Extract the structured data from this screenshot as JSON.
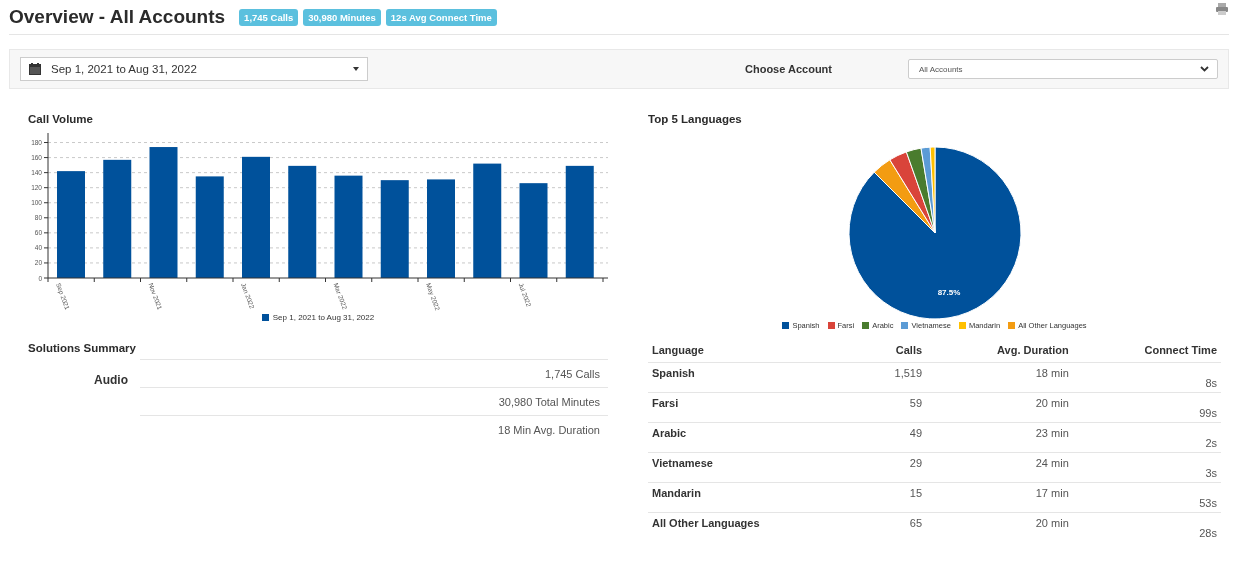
{
  "header": {
    "title": "Overview - All Accounts",
    "badges": [
      "1,745 Calls",
      "30,980 Minutes",
      "12s Avg Connect Time"
    ]
  },
  "filters": {
    "date_range": "Sep 1, 2021 to Aug 31, 2022",
    "account_label": "Choose Account",
    "account_value": "All Accounts"
  },
  "call_volume": {
    "title": "Call Volume",
    "chart_data": {
      "type": "bar",
      "series": [
        {
          "name": "Sep 1, 2021 to Aug 31, 2022",
          "color": "#00519b",
          "values": [
            142,
            157,
            174,
            135,
            161,
            149,
            136,
            130,
            131,
            152,
            126,
            149
          ]
        }
      ],
      "categories": [
        "Sep 2021",
        null,
        "Nov 2021",
        null,
        "Jan 2022",
        null,
        "Mar 2022",
        null,
        "May 2022",
        null,
        "Jul 2022",
        null
      ],
      "grid": true,
      "legend": "bottom",
      "ylim": [
        0,
        190
      ],
      "yticks": [
        0,
        20,
        40,
        60,
        80,
        100,
        120,
        140,
        160,
        180
      ]
    }
  },
  "solutions_summary": {
    "title": "Solutions Summary",
    "groups": [
      {
        "label": "Audio",
        "lines": [
          "1,745 Calls",
          "30,980 Total Minutes",
          "18 Min Avg. Duration"
        ]
      }
    ]
  },
  "top_languages": {
    "title": "Top 5 Languages",
    "chart_data": {
      "type": "pie",
      "categories": [
        "Spanish",
        "Farsi",
        "Arabic",
        "Vietnamese",
        "Mandarin",
        "All Other Languages"
      ],
      "values": [
        87.5,
        3.4,
        2.8,
        1.7,
        0.9,
        3.7
      ],
      "legend": "bottom",
      "colors": [
        "#00519b",
        "#d9443a",
        "#4a7c2e",
        "#5b9bd5",
        "#ffc000",
        "#f39c12"
      ],
      "value_labels": [
        "87.5%",
        null,
        null,
        null,
        null,
        null
      ]
    }
  },
  "language_table": {
    "columns": [
      "Language",
      "Calls",
      "Avg. Duration",
      "Connect Time"
    ],
    "rows": [
      [
        "Spanish",
        "1,519",
        "18 min",
        "8s"
      ],
      [
        "Farsi",
        "59",
        "20 min",
        "99s"
      ],
      [
        "Arabic",
        "49",
        "23 min",
        "2s"
      ],
      [
        "Vietnamese",
        "29",
        "24 min",
        "3s"
      ],
      [
        "Mandarin",
        "15",
        "17 min",
        "53s"
      ],
      [
        "All Other Languages",
        "65",
        "20 min",
        "28s"
      ]
    ]
  }
}
